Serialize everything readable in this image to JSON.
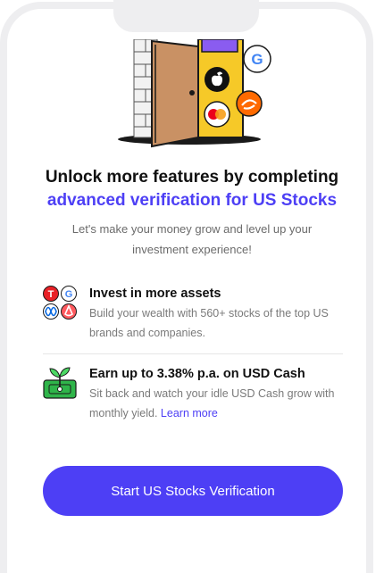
{
  "hero": {
    "logos": [
      "apple-logo",
      "google-logo",
      "mastercard-logo",
      "alibaba-logo"
    ]
  },
  "heading": {
    "line1": "Unlock more features by completing",
    "line2": "advanced verification for US Stocks"
  },
  "subtitle": "Let's make your money grow and level up your investment experience!",
  "features": [
    {
      "title": "Invest in more assets",
      "description": "Build your wealth with 560+ stocks of the top US brands and companies.",
      "icon": "brand-logos-icon"
    },
    {
      "title": "Earn up to 3.38% p.a. on USD Cash",
      "description": "Sit back and watch your idle USD Cash grow with monthly yield.",
      "link": "Learn more",
      "icon": "plant-cash-icon"
    }
  ],
  "cta": {
    "label": "Start US Stocks Verification"
  },
  "colors": {
    "accent": "#4d3ff5",
    "frame": "#eeeef0"
  }
}
